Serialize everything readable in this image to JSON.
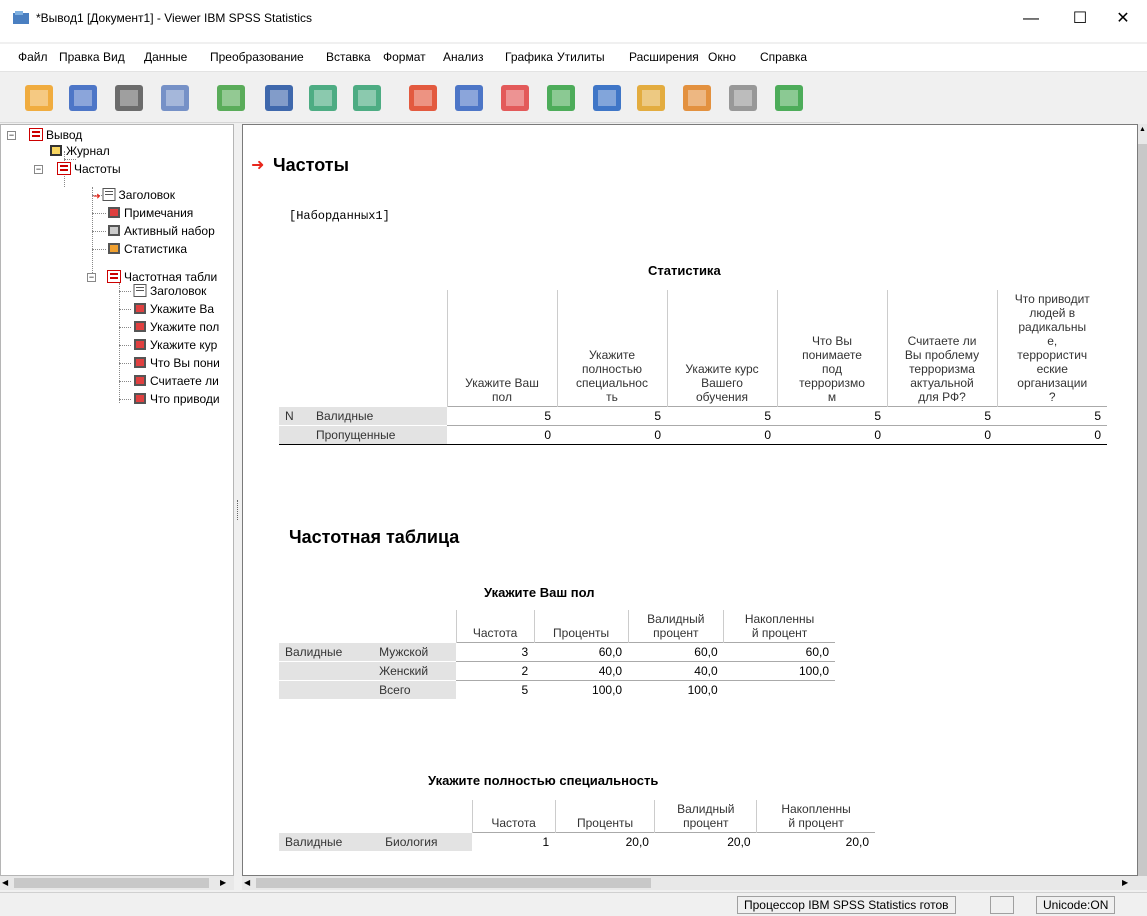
{
  "window": {
    "title": "*Вывод1 [Документ1] - Viewer IBM SPSS Statistics",
    "minimize": "—",
    "maximize": "☐",
    "close": "✕"
  },
  "menu": [
    "Файл",
    "Правка",
    "Вид",
    "Данные",
    "Преобразование",
    "Вставка",
    "Формат",
    "Анализ",
    "Графика",
    "Утилиты",
    "Расширения",
    "Окно",
    "Справка"
  ],
  "toolbar_icons": [
    "open-icon",
    "save-icon",
    "print-icon",
    "print-preview-icon",
    "export-icon",
    "recall-dialog-icon",
    "undo-icon",
    "redo-icon",
    "goto-data-icon",
    "goto-case-icon",
    "insert-variable-icon",
    "show-output-icon",
    "designate-window-icon",
    "create-title-icon",
    "run-script-icon",
    "disabled-icon",
    "add-icon"
  ],
  "outline": {
    "root": "Вывод",
    "journal": "Журнал",
    "freq": "Частоты",
    "children": [
      "Заголовок",
      "Примечания",
      "Активный набор",
      "Статистика"
    ],
    "table_node": "Частотная табли",
    "table_children": [
      "Заголовок",
      "Укажите Ва",
      "Укажите пол",
      "Укажите кур",
      "Что Вы пони",
      "Считаете ли",
      "Что приводи"
    ]
  },
  "content": {
    "section_title": "Частоты",
    "dataset": "[Наборданных1]",
    "stats": {
      "title": "Статистика",
      "headers": [
        "Укажите Ваш\nпол",
        "Укажите\nполностью\nспециальнос\nть",
        "Укажите курс\nВашего\nобучения",
        "Что Вы\nпонимаете\nпод\nтерроризмо\nм",
        "Считаете ли\nВы проблему\nтерроризма\nактуальной\nдля РФ?",
        "Что приводит\nлюдей в\nрадикальны\nе,\nтеррористич\nеские\nорганизации\n?"
      ],
      "n_label": "N",
      "rows": [
        {
          "label": "Валидные",
          "values": [
            "5",
            "5",
            "5",
            "5",
            "5",
            "5"
          ]
        },
        {
          "label": "Пропущенные",
          "values": [
            "0",
            "0",
            "0",
            "0",
            "0",
            "0"
          ]
        }
      ]
    },
    "freq_section": "Частотная таблица",
    "t1": {
      "title": "Укажите Ваш пол",
      "headers": [
        "Частота",
        "Проценты",
        "Валидный\nпроцент",
        "Накопленны\nй процент"
      ],
      "group": "Валидные",
      "rows": [
        {
          "label": "Мужской",
          "values": [
            "3",
            "60,0",
            "60,0",
            "60,0"
          ]
        },
        {
          "label": "Женский",
          "values": [
            "2",
            "40,0",
            "40,0",
            "100,0"
          ]
        },
        {
          "label": "Всего",
          "values": [
            "5",
            "100,0",
            "100,0",
            ""
          ]
        }
      ]
    },
    "t2": {
      "title": "Укажите полностью специальность",
      "headers": [
        "Частота",
        "Проценты",
        "Валидный\nпроцент",
        "Накопленны\nй процент"
      ],
      "group": "Валидные",
      "rows": [
        {
          "label": "Биология",
          "values": [
            "1",
            "20,0",
            "20,0",
            "20,0"
          ]
        }
      ]
    }
  },
  "status": {
    "processor": "Процессор IBM SPSS Statistics  готов",
    "unicode": "Unicode:ON"
  }
}
